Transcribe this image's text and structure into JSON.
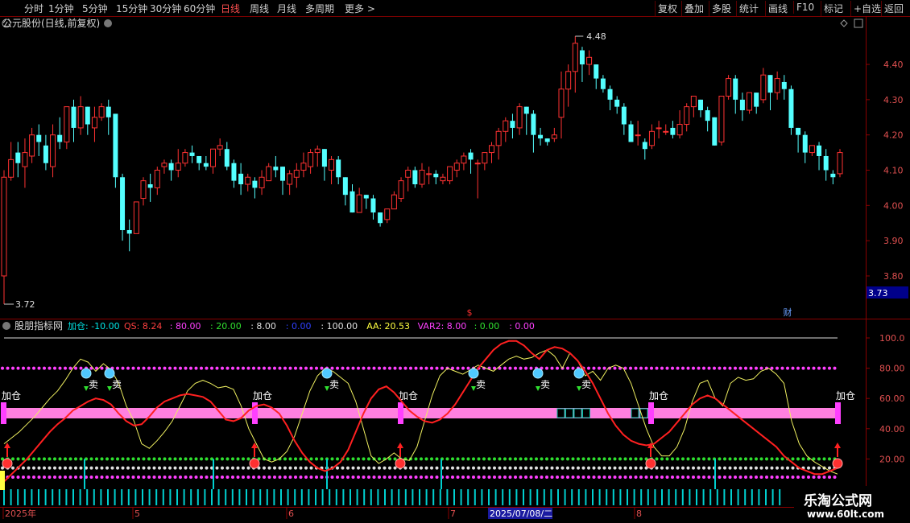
{
  "toolbar": {
    "periods": [
      "分时",
      "1分钟",
      "5分钟",
      "15分钟",
      "30分钟",
      "60分钟",
      "日线",
      "周线",
      "月线",
      "多周期",
      "更多"
    ],
    "active_period": "日线",
    "right_buttons": [
      "复权",
      "叠加",
      "多股",
      "统计",
      "画线",
      "F10",
      "标记",
      "+自选",
      "返回"
    ]
  },
  "main_chart": {
    "title": "公元股份(日线,前复权)",
    "price_ticks": [
      "4.40",
      "4.30",
      "4.20",
      "4.10",
      "4.00",
      "3.90",
      "3.80"
    ],
    "high_label": "4.48",
    "low_label": "3.72",
    "last_price": "3.73",
    "marker_s": "$",
    "marker_cai": "财"
  },
  "indicator": {
    "name": "股朋指标网",
    "legend": [
      {
        "text": "加仓: -10.00",
        "color": "#00e5e5"
      },
      {
        "text": "QS: 8.24",
        "color": "#ff4040"
      },
      {
        "text": ": 80.00",
        "color": "#ff40ff"
      },
      {
        "text": ": 20.00",
        "color": "#30e030"
      },
      {
        "text": ": 8.00",
        "color": "#e0e0e0"
      },
      {
        "text": ": 0.00",
        "color": "#3040ff"
      },
      {
        "text": ": 100.00",
        "color": "#e0e0e0"
      },
      {
        "text": "AA: 20.53",
        "color": "#ffff40"
      },
      {
        "text": "VAR2: 8.00",
        "color": "#ff40ff"
      },
      {
        "text": ": 0.00",
        "color": "#30e030"
      },
      {
        "text": ": 0.00",
        "color": "#ff40ff"
      }
    ],
    "ticks": [
      "100.0",
      "80.00",
      "60.00",
      "40.00",
      "20.00"
    ],
    "add_label": "加仓",
    "sell_label": "卖"
  },
  "date_axis": {
    "labels": [
      "2025年",
      "5",
      "6",
      "7",
      "8"
    ],
    "cursor_date": "2025/07/08/二"
  },
  "watermark": {
    "line1": "乐淘公式网",
    "line2": "www.60lt.com"
  },
  "chart_data": {
    "type": "candlestick",
    "title": "公元股份(日线,前复权)",
    "y_range": [
      3.72,
      4.48
    ],
    "candles": [
      [
        3.8,
        4.08,
        3.72,
        4.1
      ],
      [
        4.08,
        4.13,
        4.07,
        4.18
      ],
      [
        4.15,
        4.12,
        4.08,
        4.18
      ],
      [
        4.11,
        4.15,
        4.05,
        4.19
      ],
      [
        4.14,
        4.2,
        4.12,
        4.22
      ],
      [
        4.2,
        4.18,
        4.14,
        4.23
      ],
      [
        4.17,
        4.12,
        4.1,
        4.2
      ],
      [
        4.11,
        4.2,
        4.08,
        4.23
      ],
      [
        4.2,
        4.18,
        4.16,
        4.25
      ],
      [
        4.18,
        4.28,
        4.16,
        4.28
      ],
      [
        4.28,
        4.22,
        4.18,
        4.3
      ],
      [
        4.22,
        4.28,
        4.2,
        4.31
      ],
      [
        4.28,
        4.23,
        4.2,
        4.28
      ],
      [
        4.22,
        4.25,
        4.18,
        4.28
      ],
      [
        4.25,
        4.28,
        4.24,
        4.29
      ],
      [
        4.28,
        4.25,
        4.2,
        4.3
      ],
      [
        4.26,
        4.08,
        4.05,
        4.1
      ],
      [
        4.08,
        3.93,
        3.9,
        4.09
      ],
      [
        3.93,
        3.92,
        3.87,
        3.96
      ],
      [
        3.92,
        4.01,
        3.92,
        4.01
      ],
      [
        4.02,
        4.07,
        4.0,
        4.08
      ],
      [
        4.06,
        4.05,
        4.01,
        4.09
      ],
      [
        4.05,
        4.1,
        4.03,
        4.11
      ],
      [
        4.11,
        4.12,
        4.09,
        4.13
      ],
      [
        4.12,
        4.1,
        4.07,
        4.13
      ],
      [
        4.1,
        4.12,
        4.08,
        4.16
      ],
      [
        4.12,
        4.15,
        4.11,
        4.16
      ],
      [
        4.15,
        4.14,
        4.12,
        4.17
      ],
      [
        4.14,
        4.12,
        4.1,
        4.14
      ],
      [
        4.12,
        4.11,
        4.1,
        4.14
      ],
      [
        4.11,
        4.16,
        4.09,
        4.16
      ],
      [
        4.16,
        4.17,
        4.14,
        4.19
      ],
      [
        4.16,
        4.11,
        4.1,
        4.18
      ],
      [
        4.12,
        4.07,
        4.05,
        4.13
      ],
      [
        4.09,
        4.06,
        4.03,
        4.12
      ],
      [
        4.06,
        4.08,
        4.04,
        4.09
      ],
      [
        4.07,
        4.05,
        4.02,
        4.08
      ],
      [
        4.05,
        4.08,
        4.03,
        4.1
      ],
      [
        4.07,
        4.11,
        4.07,
        4.12
      ],
      [
        4.11,
        4.1,
        4.08,
        4.14
      ],
      [
        4.11,
        4.07,
        4.03,
        4.11
      ],
      [
        4.06,
        4.09,
        4.03,
        4.1
      ],
      [
        4.08,
        4.1,
        4.05,
        4.12
      ],
      [
        4.1,
        4.12,
        4.08,
        4.15
      ],
      [
        4.11,
        4.15,
        4.09,
        4.16
      ],
      [
        4.15,
        4.16,
        4.11,
        4.17
      ],
      [
        4.16,
        4.11,
        4.07,
        4.16
      ],
      [
        4.1,
        4.13,
        4.06,
        4.14
      ],
      [
        4.13,
        4.08,
        4.06,
        4.14
      ],
      [
        4.08,
        4.03,
        4.0,
        4.08
      ],
      [
        4.04,
        3.98,
        3.98,
        4.06
      ],
      [
        3.98,
        4.03,
        3.98,
        4.05
      ],
      [
        4.03,
        4.02,
        3.99,
        4.03
      ],
      [
        4.02,
        3.98,
        3.96,
        4.03
      ],
      [
        3.98,
        3.95,
        3.94,
        3.98
      ],
      [
        3.96,
        3.99,
        3.95,
        3.99
      ],
      [
        3.99,
        4.03,
        3.99,
        4.04
      ],
      [
        4.02,
        4.07,
        4.01,
        4.08
      ],
      [
        4.08,
        4.1,
        4.04,
        4.11
      ],
      [
        4.1,
        4.06,
        4.05,
        4.11
      ],
      [
        4.06,
        4.1,
        4.05,
        4.12
      ],
      [
        4.09,
        4.09,
        4.06,
        4.11
      ],
      [
        4.09,
        4.08,
        4.06,
        4.1
      ],
      [
        4.07,
        4.08,
        4.06,
        4.09
      ],
      [
        4.07,
        4.11,
        4.06,
        4.11
      ],
      [
        4.1,
        4.12,
        4.08,
        4.13
      ],
      [
        4.12,
        4.14,
        4.1,
        4.15
      ],
      [
        4.15,
        4.13,
        4.09,
        4.16
      ],
      [
        4.12,
        4.12,
        4.02,
        4.13
      ],
      [
        4.12,
        4.15,
        4.1,
        4.15
      ],
      [
        4.15,
        4.17,
        4.12,
        4.18
      ],
      [
        4.17,
        4.21,
        4.13,
        4.22
      ],
      [
        4.21,
        4.24,
        4.18,
        4.25
      ],
      [
        4.24,
        4.22,
        4.19,
        4.26
      ],
      [
        4.22,
        4.28,
        4.2,
        4.29
      ],
      [
        4.28,
        4.26,
        4.2,
        4.28
      ],
      [
        4.26,
        4.2,
        4.15,
        4.27
      ],
      [
        4.2,
        4.19,
        4.17,
        4.22
      ],
      [
        4.19,
        4.18,
        4.17,
        4.19
      ],
      [
        4.19,
        4.2,
        4.18,
        4.22
      ],
      [
        4.25,
        4.33,
        4.19,
        4.38
      ],
      [
        4.33,
        4.38,
        4.28,
        4.4
      ],
      [
        4.38,
        4.46,
        4.32,
        4.48
      ],
      [
        4.44,
        4.4,
        4.35,
        4.45
      ],
      [
        4.4,
        4.42,
        4.37,
        4.44
      ],
      [
        4.4,
        4.36,
        4.33,
        4.4
      ],
      [
        4.36,
        4.33,
        4.32,
        4.37
      ],
      [
        4.33,
        4.3,
        4.27,
        4.34
      ],
      [
        4.3,
        4.28,
        4.26,
        4.31
      ],
      [
        4.28,
        4.23,
        4.2,
        4.29
      ],
      [
        4.23,
        4.18,
        4.18,
        4.24
      ],
      [
        4.2,
        4.2,
        4.17,
        4.24
      ],
      [
        4.18,
        4.16,
        4.13,
        4.19
      ],
      [
        4.17,
        4.21,
        4.16,
        4.23
      ],
      [
        4.22,
        4.22,
        4.19,
        4.24
      ],
      [
        4.21,
        4.21,
        4.2,
        4.23
      ],
      [
        4.22,
        4.2,
        4.19,
        4.24
      ],
      [
        4.2,
        4.23,
        4.19,
        4.27
      ],
      [
        4.23,
        4.28,
        4.21,
        4.29
      ],
      [
        4.28,
        4.31,
        4.25,
        4.31
      ],
      [
        4.3,
        4.27,
        4.25,
        4.3
      ],
      [
        4.27,
        4.24,
        4.21,
        4.28
      ],
      [
        4.25,
        4.17,
        4.17,
        4.25
      ],
      [
        4.18,
        4.31,
        4.17,
        4.31
      ],
      [
        4.31,
        4.36,
        4.3,
        4.37
      ],
      [
        4.36,
        4.3,
        4.26,
        4.37
      ],
      [
        4.3,
        4.27,
        4.24,
        4.32
      ],
      [
        4.27,
        4.32,
        4.26,
        4.32
      ],
      [
        4.32,
        4.28,
        4.26,
        4.32
      ],
      [
        4.3,
        4.37,
        4.29,
        4.39
      ],
      [
        4.37,
        4.32,
        4.27,
        4.37
      ],
      [
        4.32,
        4.36,
        4.3,
        4.38
      ],
      [
        4.35,
        4.33,
        4.3,
        4.37
      ],
      [
        4.33,
        4.22,
        4.2,
        4.34
      ],
      [
        4.22,
        4.2,
        4.15,
        4.22
      ],
      [
        4.2,
        4.15,
        4.12,
        4.21
      ],
      [
        4.15,
        4.17,
        4.14,
        4.17
      ],
      [
        4.17,
        4.14,
        4.1,
        4.18
      ],
      [
        4.14,
        4.1,
        4.07,
        4.16
      ],
      [
        4.09,
        4.08,
        4.06,
        4.1
      ],
      [
        4.09,
        4.15,
        4.08,
        4.16
      ]
    ]
  }
}
